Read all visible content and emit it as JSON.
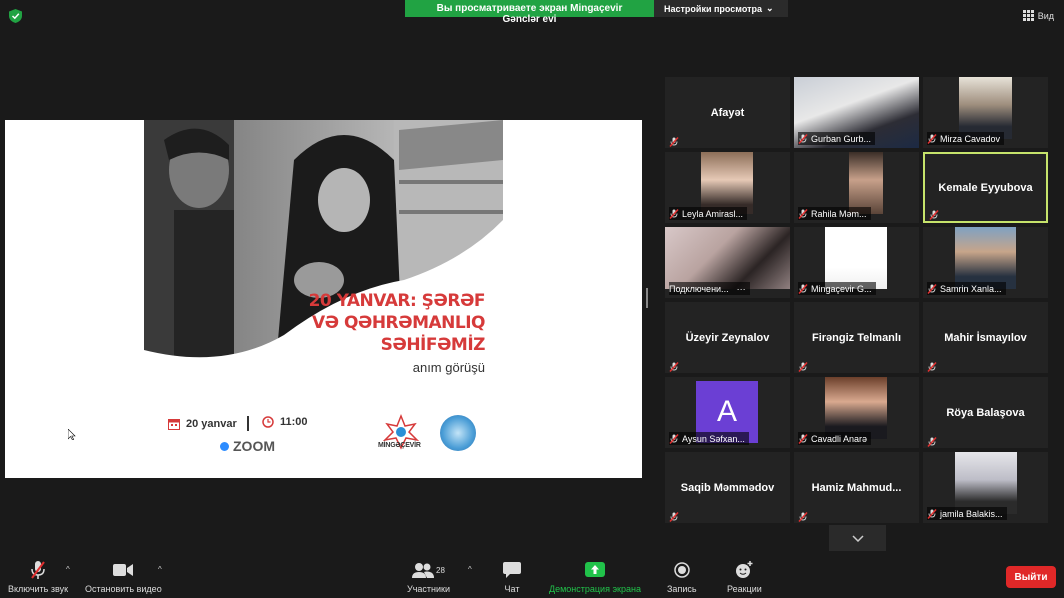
{
  "top_bar": {
    "share_banner": "Вы просматриваете экран Mingaçevir Gənclər evi",
    "view_options": "Настройки просмотра",
    "view_button": "Вид"
  },
  "shared_screen": {
    "title_lines": [
      "20 YANVAR: ŞƏRƏF",
      "VƏ QƏHRƏMANLIQ",
      "SƏHİFƏMİZ"
    ],
    "subtitle": "anım görüşü",
    "date": "20 yanvar",
    "time": "11:00",
    "platform": "ZOOM",
    "logo_text": "MİNGƏÇEVİR"
  },
  "participants": [
    {
      "name": "Afayət",
      "type": "name"
    },
    {
      "name": "Gurban Gurb...",
      "type": "video"
    },
    {
      "name": "Mirza Cavadov",
      "type": "video"
    },
    {
      "name": "Leyla Amirasl...",
      "type": "video"
    },
    {
      "name": "Rahila Məm...",
      "type": "video"
    },
    {
      "name": "Kemale Eyyubova",
      "type": "name",
      "active": true
    },
    {
      "name": "Подключени...",
      "type": "video",
      "more": "···"
    },
    {
      "name": "Mingaçevir G...",
      "type": "video"
    },
    {
      "name": "Samrin Xanla...",
      "type": "video"
    },
    {
      "name": "Üzeyir Zeynalov",
      "type": "name"
    },
    {
      "name": "Firəngiz Telmanlı",
      "type": "name"
    },
    {
      "name": "Mahir İsmayılov",
      "type": "name"
    },
    {
      "name": "Aysun Səfxan...",
      "type": "avatar",
      "initial": "A"
    },
    {
      "name": "Cavadli Anarə",
      "type": "video"
    },
    {
      "name": "Röya Balaşova",
      "type": "name"
    },
    {
      "name": "Saqib Məmmədov",
      "type": "name"
    },
    {
      "name": "Hamiz  Mahmud...",
      "type": "name"
    },
    {
      "name": "jamila Balakis...",
      "type": "video"
    }
  ],
  "toolbar": {
    "unmute": "Включить звук",
    "stop_video": "Остановить видео",
    "participants": "Участники",
    "participants_count": "28",
    "chat": "Чат",
    "share_screen": "Демонстрация экрана",
    "record": "Запись",
    "reactions": "Реакции",
    "leave": "Выйти"
  },
  "colors": {
    "share_green": "#21a343",
    "active_speaker": "#c6e36b",
    "leave_red": "#e02828",
    "mute_red": "#e03030"
  }
}
